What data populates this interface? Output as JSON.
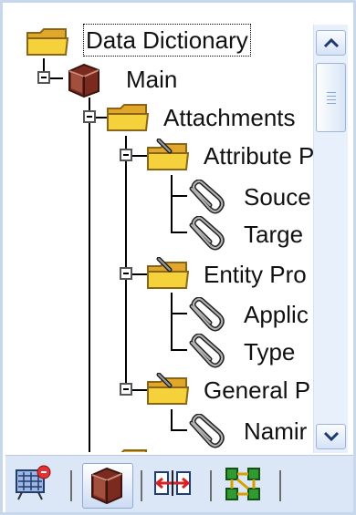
{
  "tree": {
    "root": "Data Dictionary",
    "main": "Main",
    "attachments": "Attachments",
    "attribute_props": "Attribute P",
    "source": "Souce",
    "target": "Targe",
    "entity_props": "Entity Pro",
    "applies": "Applic",
    "type": "Type",
    "general_props": "General P",
    "naming": "Namir"
  },
  "toolbar": {
    "buttons": [
      "model-explorer",
      "data-dictionary",
      "compare",
      "diagram"
    ]
  },
  "colors": {
    "folder": "#f5d13b",
    "accent_border": "#c7d7ec",
    "toolbar_bg": "#dbe6f6"
  }
}
